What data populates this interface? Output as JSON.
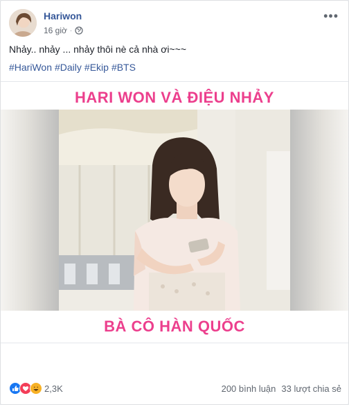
{
  "post": {
    "author": "Hariwon",
    "time": "16 giờ",
    "separator": "·",
    "privacy_icon": "globe-icon",
    "more_icon": "more-options-icon",
    "more_glyph": "•••",
    "text": "Nhảy.. nhảy ... nhảy thôi nè cả nhà ơi~~~",
    "hashtags": [
      "#HariWon",
      "#Daily",
      "#Ekip",
      "#BTS"
    ]
  },
  "video": {
    "title_top": "HARI WON VÀ ĐIỆU NHẢY",
    "title_bottom": "BÀ CÔ HÀN QUỐC",
    "volume_icon": "volume-icon"
  },
  "footer": {
    "reaction_icons": [
      "like-icon",
      "love-icon",
      "haha-icon"
    ],
    "reaction_count": "2,3K",
    "comments": "200 bình luận",
    "shares": "33 lượt chia sẻ"
  },
  "colors": {
    "link": "#365899",
    "video_title": "#ec3f8d",
    "like": "#1877f2",
    "love": "#f33e58",
    "haha": "#f7b125"
  }
}
